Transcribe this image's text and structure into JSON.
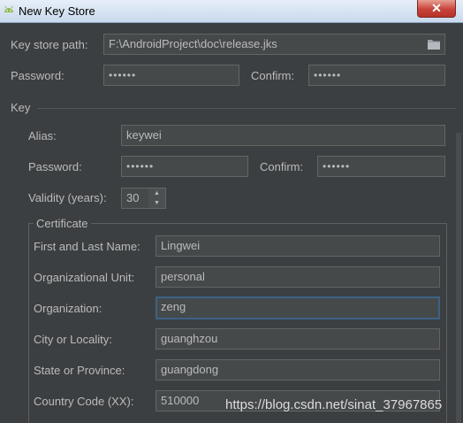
{
  "window": {
    "title": "New Key Store",
    "close_glyph": "✕",
    "icons": {
      "title": "android-icon",
      "folder": "folder-icon"
    }
  },
  "keystore": {
    "path_label": "Key store path:",
    "path_value": "F:\\AndroidProject\\doc\\release.jks",
    "password_label": "Password:",
    "password_value": "••••••",
    "confirm_label": "Confirm:",
    "confirm_value": "••••••"
  },
  "key": {
    "section_label": "Key",
    "alias_label": "Alias:",
    "alias_value": "keywei",
    "password_label": "Password:",
    "password_value": "••••••",
    "confirm_label": "Confirm:",
    "confirm_value": "••••••",
    "validity_label": "Validity (years):",
    "validity_value": "30",
    "spinner_up": "▲",
    "spinner_down": "▼"
  },
  "certificate": {
    "section_label": "Certificate",
    "fields": [
      {
        "label": "First and Last Name:",
        "value": "Lingwei"
      },
      {
        "label": "Organizational Unit:",
        "value": "personal"
      },
      {
        "label": "Organization:",
        "value": "zeng"
      },
      {
        "label": "City or Locality:",
        "value": "guanghzou"
      },
      {
        "label": "State or Province:",
        "value": "guangdong"
      },
      {
        "label": "Country Code (XX):",
        "value": "510000"
      }
    ]
  },
  "watermark": "https://blog.csdn.net/sinat_37967865",
  "colors": {
    "background": "#3c3f41",
    "field": "#45494a",
    "text": "#bbbbbb",
    "focus": "#3d6185"
  }
}
